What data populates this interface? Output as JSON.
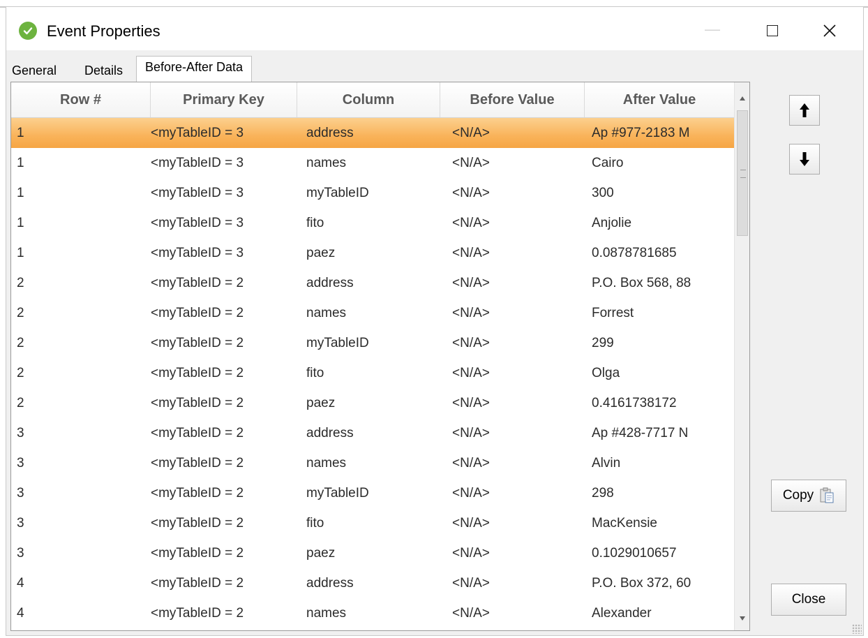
{
  "window": {
    "title": "Event Properties",
    "minimize_glyph": "—",
    "icons": {
      "app": "green-check-icon",
      "maximize": "maximize-icon",
      "close": "close-icon"
    }
  },
  "tabs": [
    {
      "label": "General",
      "active": false
    },
    {
      "label": "Details",
      "active": false
    },
    {
      "label": "Before-After Data",
      "active": true
    }
  ],
  "table": {
    "columns": [
      "Row #",
      "Primary Key",
      "Column",
      "Before Value",
      "After Value"
    ],
    "selected_row_index": 0,
    "selected_color": "#f9b35a",
    "rows": [
      [
        "1",
        "<myTableID = 3",
        "address",
        "<N/A>",
        "Ap #977-2183 M"
      ],
      [
        "1",
        "<myTableID = 3",
        "names",
        "<N/A>",
        "Cairo"
      ],
      [
        "1",
        "<myTableID = 3",
        "myTableID",
        "<N/A>",
        "300"
      ],
      [
        "1",
        "<myTableID = 3",
        "fito",
        "<N/A>",
        "Anjolie"
      ],
      [
        "1",
        "<myTableID = 3",
        "paez",
        "<N/A>",
        "0.0878781685"
      ],
      [
        "2",
        "<myTableID = 2",
        "address",
        "<N/A>",
        "P.O. Box 568, 88"
      ],
      [
        "2",
        "<myTableID = 2",
        "names",
        "<N/A>",
        "Forrest"
      ],
      [
        "2",
        "<myTableID = 2",
        "myTableID",
        "<N/A>",
        "299"
      ],
      [
        "2",
        "<myTableID = 2",
        "fito",
        "<N/A>",
        "Olga"
      ],
      [
        "2",
        "<myTableID = 2",
        "paez",
        "<N/A>",
        "0.4161738172"
      ],
      [
        "3",
        "<myTableID = 2",
        "address",
        "<N/A>",
        "Ap #428-7717 N"
      ],
      [
        "3",
        "<myTableID = 2",
        "names",
        "<N/A>",
        "Alvin"
      ],
      [
        "3",
        "<myTableID = 2",
        "myTableID",
        "<N/A>",
        "298"
      ],
      [
        "3",
        "<myTableID = 2",
        "fito",
        "<N/A>",
        "MacKensie"
      ],
      [
        "3",
        "<myTableID = 2",
        "paez",
        "<N/A>",
        "0.1029010657"
      ],
      [
        "4",
        "<myTableID = 2",
        "address",
        "<N/A>",
        "P.O. Box 372, 60"
      ],
      [
        "4",
        "<myTableID = 2",
        "names",
        "<N/A>",
        "Alexander"
      ]
    ]
  },
  "side": {
    "up_icon": "arrow-up-icon",
    "down_icon": "arrow-down-icon",
    "copy_label": "Copy",
    "copy_icon": "clipboard-icon",
    "close_label": "Close"
  }
}
